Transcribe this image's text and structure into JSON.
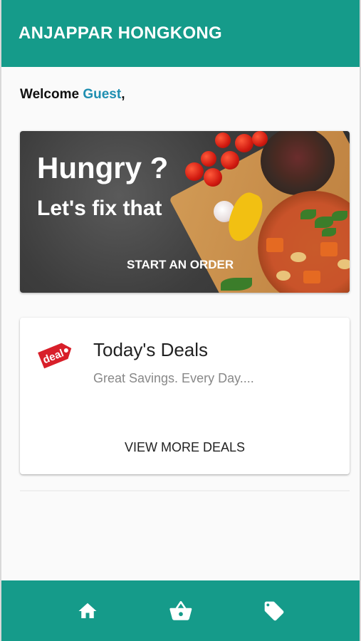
{
  "app_bar": {
    "title": "ANJAPPAR HONGKONG"
  },
  "welcome": {
    "prefix": "Welcome ",
    "user": "Guest",
    "suffix": ","
  },
  "hero": {
    "title": "Hungry ?",
    "subtitle": "Let's fix that",
    "action_label": "START AN ORDER"
  },
  "deals": {
    "title": "Today's Deals",
    "subtitle": "Great Savings. Every Day....",
    "action_label": "VIEW MORE DEALS",
    "icon_text": "deal",
    "icon": "deal-tag-icon"
  },
  "bottom_nav": {
    "items": [
      {
        "icon": "home-icon"
      },
      {
        "icon": "basket-icon"
      },
      {
        "icon": "tag-icon"
      }
    ]
  },
  "colors": {
    "primary": "#159b8a",
    "guest_link": "#1f8fb1",
    "deal_tag": "#d81f2a"
  }
}
